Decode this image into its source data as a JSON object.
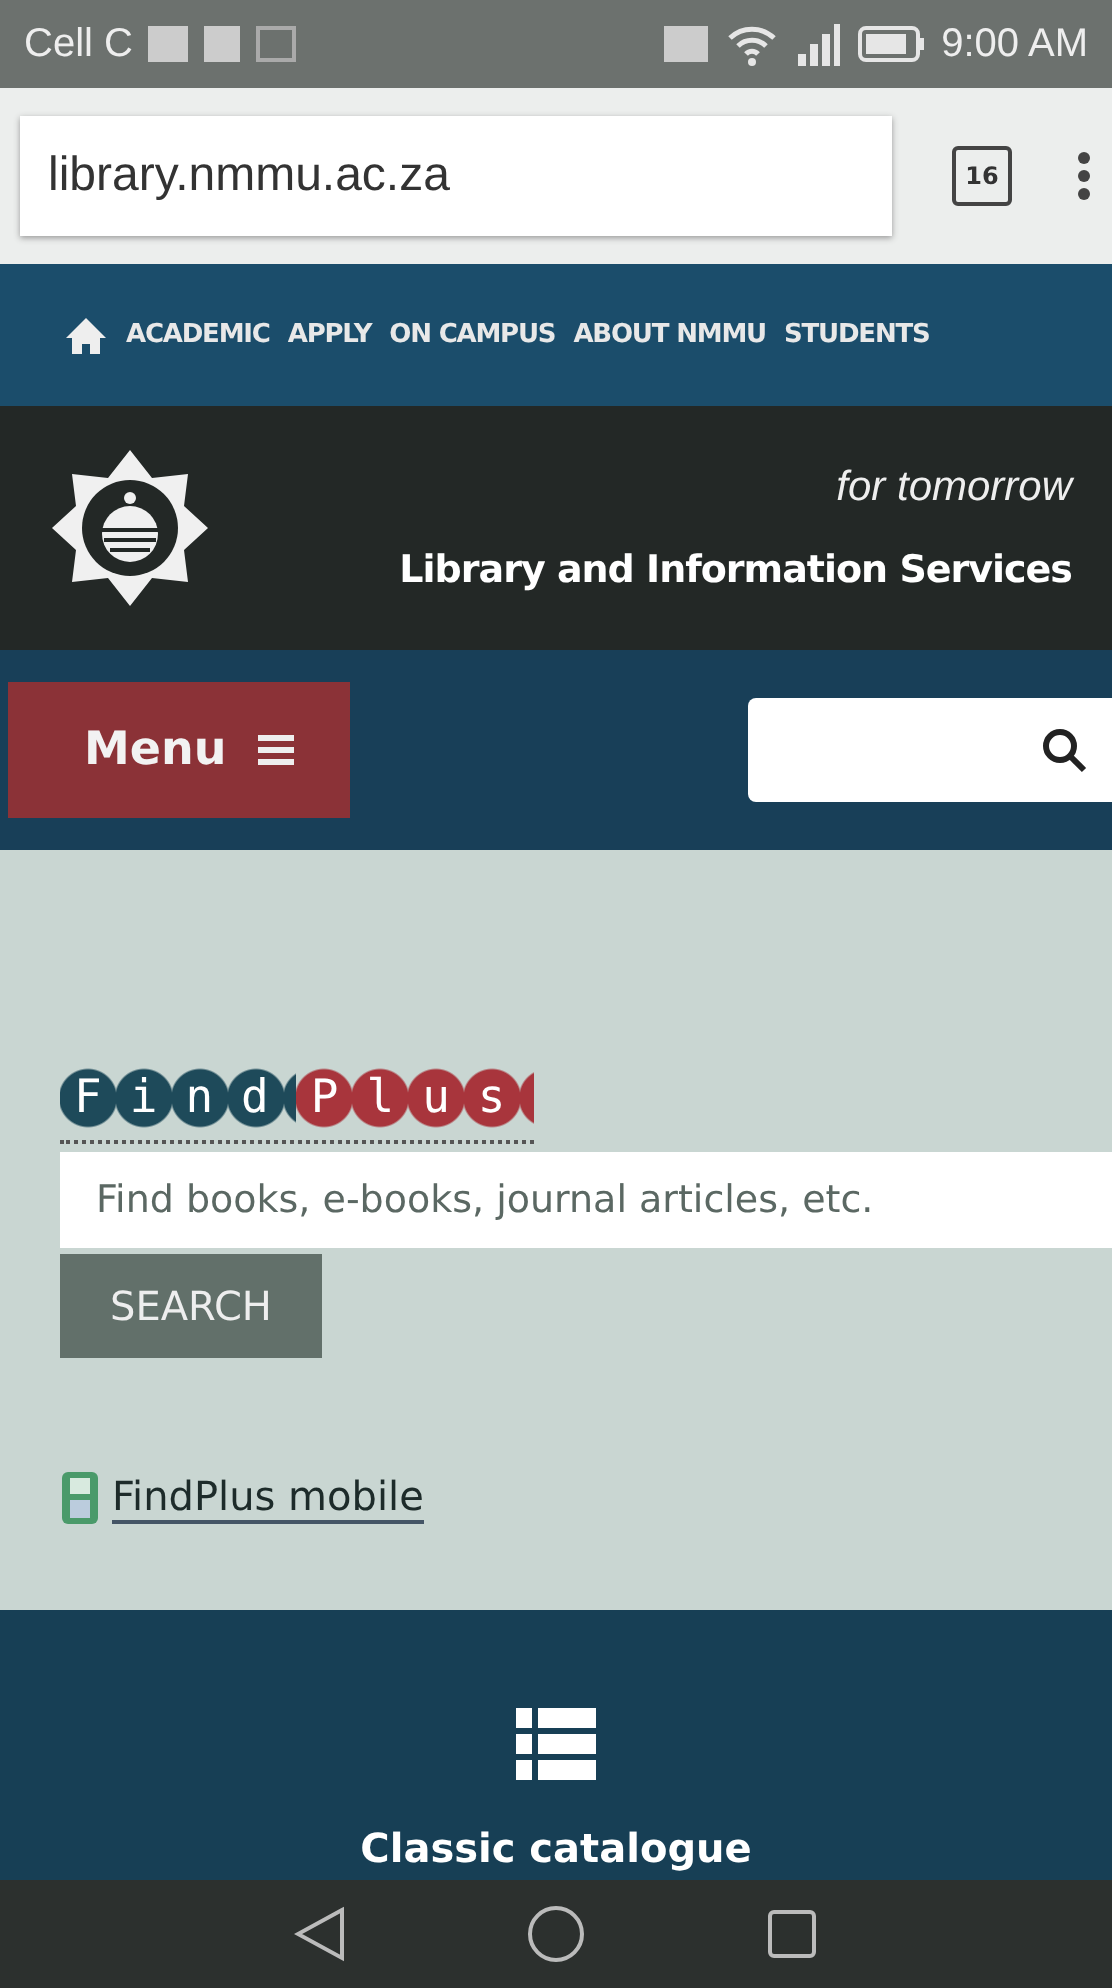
{
  "status_bar": {
    "carrier": "Cell C",
    "time": "9:00 AM"
  },
  "browser": {
    "url": "library.nmmu.ac.za",
    "tab_count": "16"
  },
  "top_nav": {
    "items": [
      "ACADEMIC",
      "APPLY",
      "ON CAMPUS",
      "ABOUT NMMU",
      "STUDENTS"
    ]
  },
  "header": {
    "tagline": "for tomorrow",
    "title": "Library and Information Services"
  },
  "menu_bar": {
    "menu_label": "Menu"
  },
  "findplus": {
    "logo": [
      {
        "text": "Find",
        "color": "#1e4a5a"
      },
      {
        "text": "Plus",
        "color": "#a8353c"
      }
    ],
    "placeholder": "Find books, e-books, journal articles, etc.",
    "search_label": "SEARCH",
    "mobile_link": "FindPlus mobile"
  },
  "footer_tile": {
    "label": "Classic catalogue"
  }
}
